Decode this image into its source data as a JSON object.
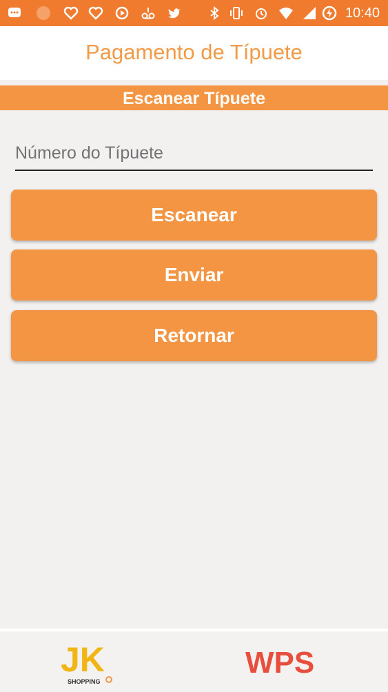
{
  "status_bar": {
    "time": "10:40",
    "icons": [
      "message-icon",
      "orange-circle-icon",
      "heart-icon",
      "heart-icon",
      "clock-icon",
      "voicemail-icon",
      "twitter-icon",
      "bluetooth-icon",
      "vibrate-icon",
      "alarm-icon",
      "wifi-icon",
      "signal-icon",
      "battery-charging-icon"
    ]
  },
  "header": {
    "title": "Pagamento de Típuete"
  },
  "section": {
    "title": "Escanear Típuete"
  },
  "form": {
    "ticket_placeholder": "Número do Típuete",
    "ticket_value": ""
  },
  "buttons": {
    "scan_label": "Escanear",
    "send_label": "Enviar",
    "return_label": "Retornar"
  },
  "footer": {
    "logo_left_text": "JK",
    "logo_left_sub": "SHOPPING",
    "logo_right_text": "WPS"
  },
  "colors": {
    "status_bar": "#f07b2f",
    "accent": "#f39543",
    "title_text": "#f39a48",
    "background": "#f3f1ef"
  }
}
